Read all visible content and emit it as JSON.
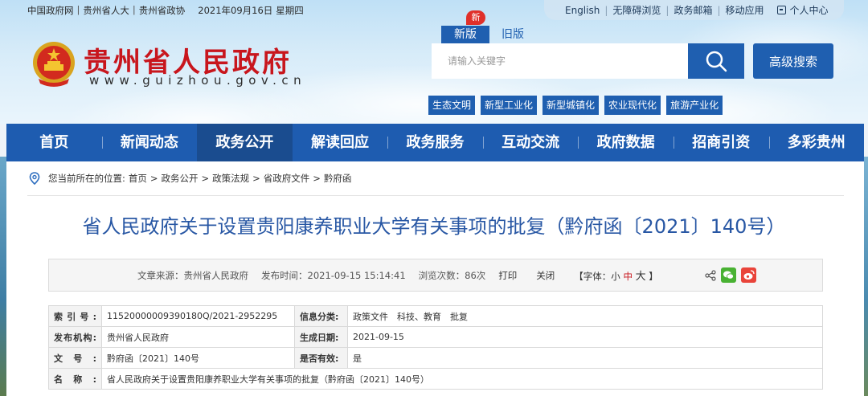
{
  "topbar": {
    "links": [
      "中国政府网",
      "贵州省人大",
      "贵州省政协"
    ],
    "date": "2021年09月16日",
    "weekday": "星期四",
    "right_links": [
      "English",
      "无障碍浏览",
      "政务邮箱",
      "移动应用"
    ],
    "user_center": "个人中心"
  },
  "site": {
    "title": "贵州省人民政府",
    "url": "www.guizhou.gov.cn"
  },
  "version": {
    "badge": "新",
    "new_label": "新版",
    "old_label": "旧版"
  },
  "search": {
    "placeholder": "请输入关键字",
    "advanced_label": "高级搜索"
  },
  "tags": [
    "生态文明",
    "新型工业化",
    "新型城镇化",
    "农业现代化",
    "旅游产业化"
  ],
  "nav": {
    "items": [
      "首页",
      "新闻动态",
      "政务公开",
      "解读回应",
      "政务服务",
      "互动交流",
      "政府数据",
      "招商引资",
      "多彩贵州"
    ],
    "active": "政务公开"
  },
  "breadcrumb": {
    "prefix": "您当前所在的位置:",
    "items": [
      "首页",
      "政务公开",
      "政策法规",
      "省政府文件",
      "黔府函"
    ],
    "separator": ">"
  },
  "article": {
    "title": "省人民政府关于设置贵阳康养职业大学有关事项的批复（黔府函〔2021〕140号）",
    "source": "文章来源：贵州省人民政府",
    "publish_time": "发布时间：2021-09-15 15:14:41",
    "views": "浏览次数：86次",
    "print": "打印",
    "close": "关闭",
    "font_size": {
      "open": "【字体：",
      "small": "小",
      "medium": "中",
      "large": "大",
      "close": "】"
    }
  },
  "info_table": {
    "rows": [
      {
        "k1": "索引号:",
        "v1": "11520000009390180Q/2021-2952295",
        "k2": "信息分类:",
        "v2": "政策文件　科技、教育　批复"
      },
      {
        "k1": "发布机构:",
        "v1": "贵州省人民政府",
        "k2": "生成日期:",
        "v2": "2021-09-15"
      },
      {
        "k1": "文号:",
        "v1": "黔府函〔2021〕140号",
        "k2": "是否有效:",
        "v2": "是"
      }
    ],
    "name_key": "名称:",
    "name_value": "省人民政府关于设置贵阳康养职业大学有关事项的批复（黔府函〔2021〕140号）"
  },
  "colors": {
    "brand_blue": "#1e5cb0",
    "title_red": "#c8161d",
    "title_blue": "#2857a4"
  }
}
